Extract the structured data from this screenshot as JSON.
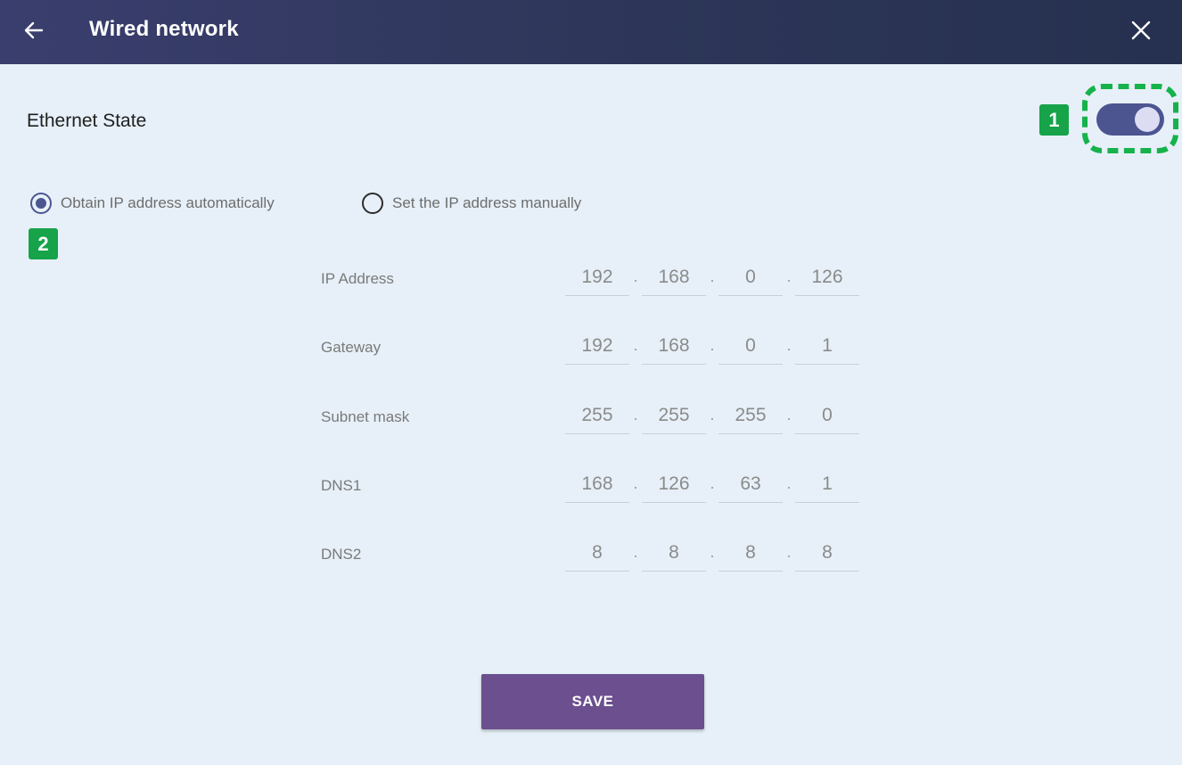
{
  "header": {
    "title": "Wired network",
    "back_icon": "arrow-left-icon",
    "close_icon": "close-icon",
    "background": "#2d3658"
  },
  "ethernet": {
    "label": "Ethernet State",
    "toggle_on": true,
    "toggle_color": "#4c5590"
  },
  "annotations": {
    "badge_1": "1",
    "badge_2": "2",
    "badge_color": "#16a34a"
  },
  "ip_mode": {
    "auto_label": "Obtain IP address automatically",
    "manual_label": "Set the IP address manually",
    "selected": "auto"
  },
  "fields": [
    {
      "label": "IP Address",
      "octets": [
        "192",
        "168",
        "0",
        "126"
      ]
    },
    {
      "label": "Gateway",
      "octets": [
        "192",
        "168",
        "0",
        "1"
      ]
    },
    {
      "label": "Subnet mask",
      "octets": [
        "255",
        "255",
        "255",
        "0"
      ]
    },
    {
      "label": "DNS1",
      "octets": [
        "168",
        "126",
        "63",
        "1"
      ]
    },
    {
      "label": "DNS2",
      "octets": [
        "8",
        "8",
        "8",
        "8"
      ]
    }
  ],
  "save_button": {
    "label": "SAVE",
    "color": "#6b4f8e"
  }
}
